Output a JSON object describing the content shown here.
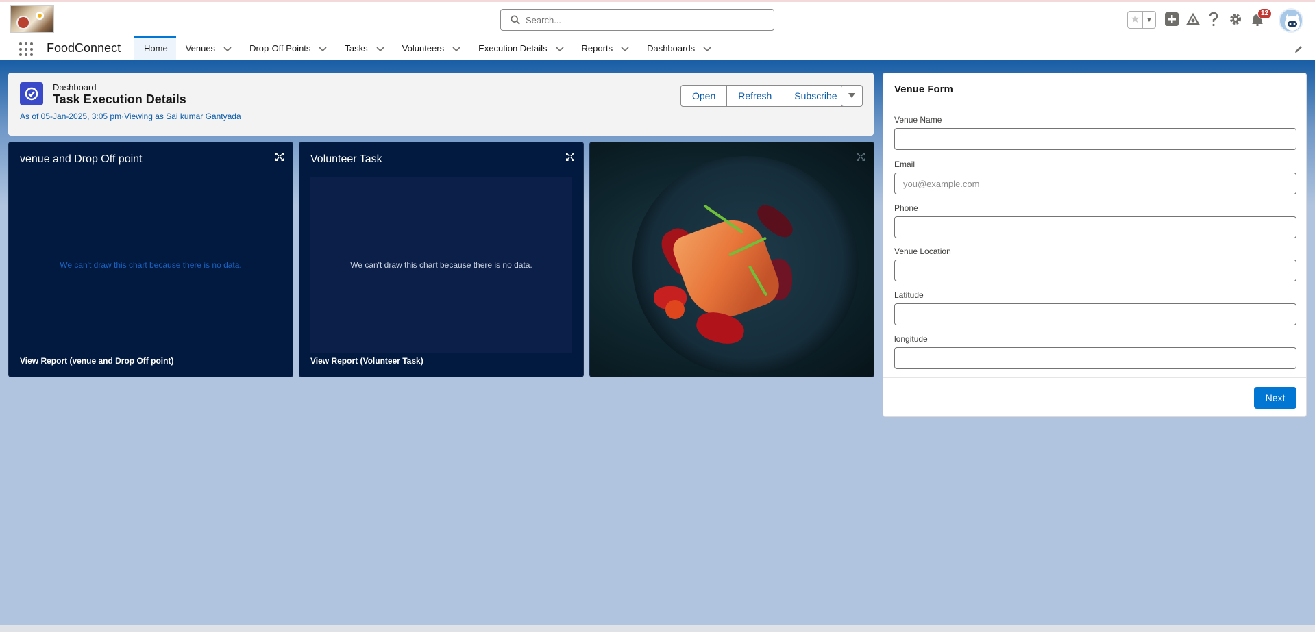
{
  "app": {
    "name": "FoodConnect",
    "search_placeholder": "Search...",
    "notification_count": "12"
  },
  "nav": {
    "tabs": [
      {
        "label": "Home",
        "active": true,
        "has_menu": false
      },
      {
        "label": "Venues",
        "has_menu": true
      },
      {
        "label": "Drop-Off Points",
        "has_menu": true
      },
      {
        "label": "Tasks",
        "has_menu": true
      },
      {
        "label": "Volunteers",
        "has_menu": true
      },
      {
        "label": "Execution Details",
        "has_menu": true
      },
      {
        "label": "Reports",
        "has_menu": true
      },
      {
        "label": "Dashboards",
        "has_menu": true
      }
    ]
  },
  "dashboard": {
    "kicker": "Dashboard",
    "title": "Task Execution Details",
    "meta": "As of 05-Jan-2025, 3:05 pm·Viewing as Sai kumar Gantyada",
    "buttons": {
      "open": "Open",
      "refresh": "Refresh",
      "subscribe": "Subscribe"
    }
  },
  "widgets": [
    {
      "title": "venue and Drop Off point",
      "no_data": "We can't draw this chart because there is no data.",
      "link": "View Report (venue and Drop Off point)"
    },
    {
      "title": "Volunteer Task",
      "no_data": "We can't draw this chart because there is no data.",
      "link": "View Report (Volunteer Task)"
    }
  ],
  "venue_form": {
    "title": "Venue Form",
    "fields": [
      {
        "label": "Venue Name",
        "value": "",
        "placeholder": ""
      },
      {
        "label": "Email",
        "value": "",
        "placeholder": "you@example.com"
      },
      {
        "label": "Phone",
        "value": "",
        "placeholder": ""
      },
      {
        "label": "Venue Location",
        "value": "",
        "placeholder": ""
      },
      {
        "label": "Latitude",
        "value": "",
        "placeholder": ""
      },
      {
        "label": "longitude",
        "value": "",
        "placeholder": ""
      }
    ],
    "next_label": "Next"
  },
  "colors": {
    "brand_blue": "#0176d3",
    "nav_underline": "#1b5fa6",
    "widget_bg": "#021a3f",
    "badge_red": "#c23934",
    "page_bg": "#b0c4df"
  },
  "icons": [
    "search-icon",
    "favorite-star-icon",
    "add-icon",
    "trailhead-icon",
    "help-icon",
    "settings-gear-icon",
    "notification-bell-icon",
    "app-launcher-icon",
    "chevron-down-icon",
    "edit-pencil-icon",
    "dashboard-icon",
    "expand-icon"
  ]
}
